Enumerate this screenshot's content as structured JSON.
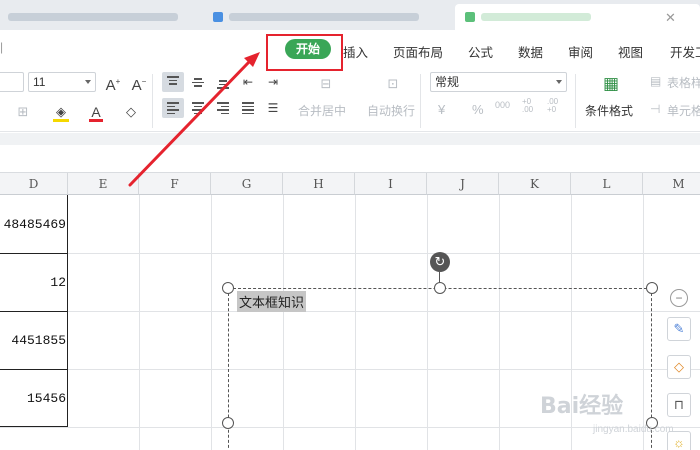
{
  "colors": {
    "accent_green": "#3aa657",
    "highlight_red": "#e5232e",
    "grid": "#e1e3e6"
  },
  "menu": {
    "start": "开始",
    "items": [
      "插入",
      "页面布局",
      "公式",
      "数据",
      "审阅",
      "视图",
      "开发工"
    ]
  },
  "ribbon": {
    "font_size": "11",
    "number_format": "常规",
    "merge_center": "合并居中",
    "wrap_text": "自动换行",
    "conditional_format": "条件格式",
    "table_style": "表格样",
    "cell": "单元格",
    "currency_symbol": "¥",
    "percent_symbol": "%",
    "thousands": "000",
    "inc_decimal": "+0 .00",
    "dec_decimal": ".00 +0"
  },
  "columns": [
    "D",
    "E",
    "F",
    "G",
    "H",
    "I",
    "J",
    "K",
    "L",
    "M"
  ],
  "cells": {
    "d1": "48485469",
    "d2": "12",
    "d3": "4451855",
    "d4": "15456"
  },
  "textbox": {
    "text": "文本框知识"
  },
  "watermark": {
    "brand": "Bai经验",
    "url": "jingyan.baidu.com"
  },
  "icons": [
    "rotate-icon",
    "collapse-icon",
    "pen-icon",
    "fill-icon",
    "border-icon",
    "bulb-icon"
  ]
}
